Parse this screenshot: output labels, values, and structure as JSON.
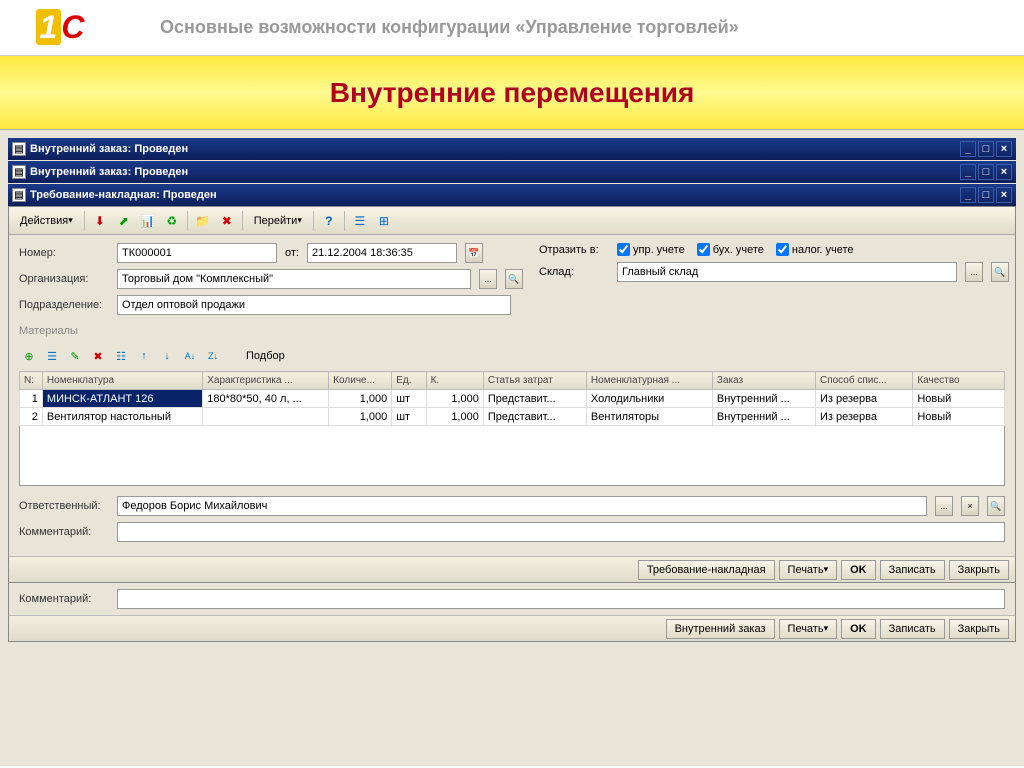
{
  "header": {
    "org_title": "Основные возможности конфигурации «Управление торговлей»"
  },
  "banner": {
    "title": "Внутренние перемещения"
  },
  "windows": [
    {
      "title": "Внутренний заказ: Проведен"
    },
    {
      "title": "Внутренний заказ: Проведен"
    },
    {
      "title": "Требование-накладная: Проведен"
    }
  ],
  "toolbar": {
    "actions": "Действия",
    "goto": "Перейти",
    "help": "?"
  },
  "form": {
    "number_label": "Номер:",
    "number": "ТК000001",
    "date_label": "от:",
    "date": "21.12.2004 18:36:35",
    "reflect_label": "Отразить в:",
    "chk_upr": "упр. учете",
    "chk_buh": "бух. учете",
    "chk_nalog": "налог. учете",
    "org_label": "Организация:",
    "org": "Торговый дом \"Комплексный\"",
    "warehouse_label": "Склад:",
    "warehouse": "Главный склад",
    "dept_label": "Подразделение:",
    "dept": "Отдел оптовой продажи",
    "materials_label": "Материалы",
    "podbor": "Подбор",
    "resp_label": "Ответственный:",
    "resp": "Федоров Борис Михайлович",
    "comment_label": "Комментарий:",
    "comment": ""
  },
  "table": {
    "headers": [
      "N:",
      "Номенклатура",
      "Характеристика ...",
      "Количе...",
      "Ед.",
      "К.",
      "Статья затрат",
      "Номенклатурная ...",
      "Заказ",
      "Способ спис...",
      "Качество"
    ],
    "rows": [
      {
        "n": "1",
        "nom": "МИНСК-АТЛАНТ 126",
        "char": "180*80*50, 40 л, ...",
        "qty": "1,000",
        "ed": "шт",
        "k": "1,000",
        "stat": "Представит...",
        "nomgrp": "Холодильники",
        "order": "Внутренний ...",
        "spis": "Из резерва",
        "quality": "Новый",
        "selected": true
      },
      {
        "n": "2",
        "nom": "Вентилятор настольный",
        "char": "",
        "qty": "1,000",
        "ed": "шт",
        "k": "1,000",
        "stat": "Представит...",
        "nomgrp": "Вентиляторы",
        "order": "Внутренний ...",
        "spis": "Из резерва",
        "quality": "Новый",
        "selected": false
      }
    ]
  },
  "bottom1": {
    "print_name": "Требование-накладная",
    "print": "Печать",
    "ok": "OK",
    "write": "Записать",
    "close": "Закрыть"
  },
  "bottom2": {
    "print_name": "Внутренний заказ",
    "print": "Печать",
    "ok": "OK",
    "write": "Записать",
    "close": "Закрыть"
  },
  "subform": {
    "comment_label": "Комментарий:",
    "comment": ""
  }
}
